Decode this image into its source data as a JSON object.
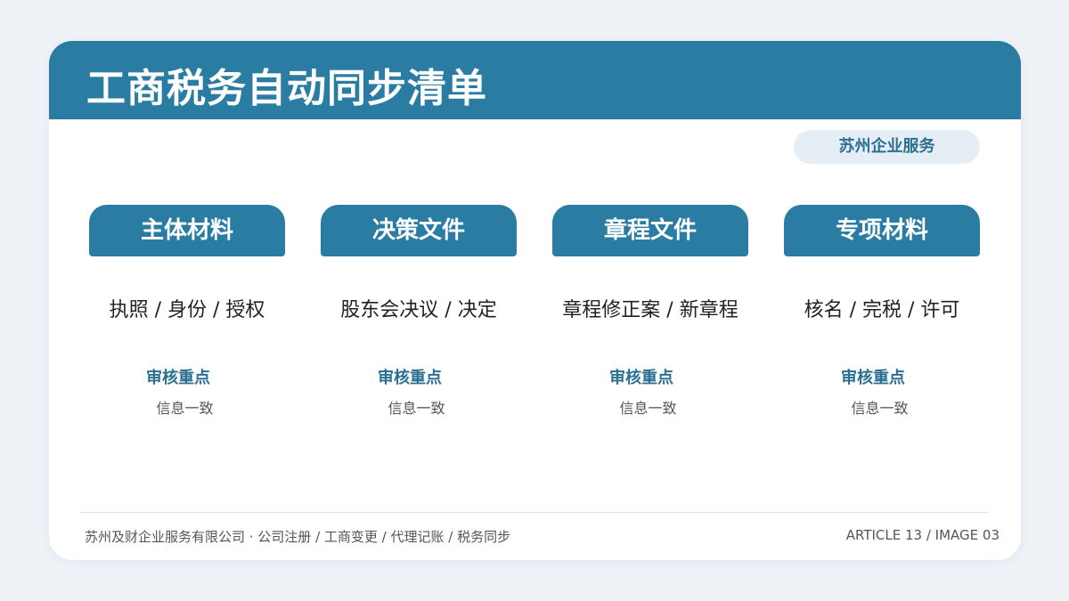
{
  "title": "工商税务自动同步清单",
  "badge": "苏州企业服务",
  "colors": {
    "accent": "#2b7ca3",
    "badge_bg": "#e6eef5",
    "page_bg": "#eef2f7"
  },
  "columns": [
    {
      "header": "主体材料",
      "desc": "执照 / 身份 / 授权",
      "review_label": "审核重点",
      "review_value": "信息一致"
    },
    {
      "header": "决策文件",
      "desc": "股东会决议 / 决定",
      "review_label": "审核重点",
      "review_value": "信息一致"
    },
    {
      "header": "章程文件",
      "desc": "章程修正案 / 新章程",
      "review_label": "审核重点",
      "review_value": "信息一致"
    },
    {
      "header": "专项材料",
      "desc": "核名 / 完税 / 许可",
      "review_label": "审核重点",
      "review_value": "信息一致"
    }
  ],
  "footer": {
    "left": "苏州及财企业服务有限公司 · 公司注册 / 工商变更 / 代理记账 / 税务同步",
    "right": "ARTICLE 13 / IMAGE 03"
  }
}
